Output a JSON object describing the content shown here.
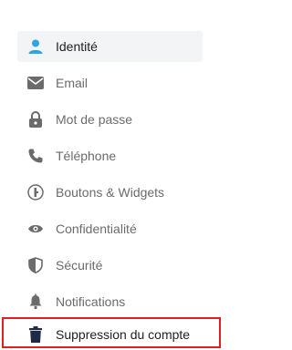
{
  "menu": {
    "items": [
      {
        "label": "Identité",
        "icon": "user-icon",
        "active": true
      },
      {
        "label": "Email",
        "icon": "envelope-icon"
      },
      {
        "label": "Mot de passe",
        "icon": "lock-icon"
      },
      {
        "label": "Téléphone",
        "icon": "phone-icon"
      },
      {
        "label": "Boutons & Widgets",
        "icon": "widgets-icon"
      },
      {
        "label": "Confidentialité",
        "icon": "eye-icon"
      },
      {
        "label": "Sécurité",
        "icon": "shield-icon"
      },
      {
        "label": "Notifications",
        "icon": "bell-icon"
      },
      {
        "label": "Suppression du compte",
        "icon": "trash-icon",
        "highlighted": true
      }
    ]
  },
  "colors": {
    "active_icon": "#2aa7e0",
    "icon": "#6b6b6b",
    "highlight_border": "#e02020",
    "active_bg": "#f3f4f6"
  }
}
